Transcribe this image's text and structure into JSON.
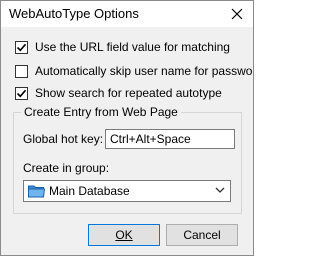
{
  "window": {
    "title": "WebAutoType Options"
  },
  "options": [
    {
      "label": "Use the URL field value for matching",
      "checked": true
    },
    {
      "label": "Automatically skip user name for passwords",
      "checked": false
    },
    {
      "label": "Show search for repeated autotype",
      "checked": true
    }
  ],
  "create_entry": {
    "legend": "Create Entry from Web Page",
    "hotkey_label": "Global hot key:",
    "hotkey_value": "Ctrl+Alt+Space",
    "group_label": "Create in group:",
    "group_value": "Main Database",
    "folder_icon": "folder-icon"
  },
  "buttons": {
    "ok_label": "OK",
    "cancel_label": "Cancel"
  },
  "colors": {
    "accent": "#0078d7",
    "folder": "#3c8dd9"
  }
}
